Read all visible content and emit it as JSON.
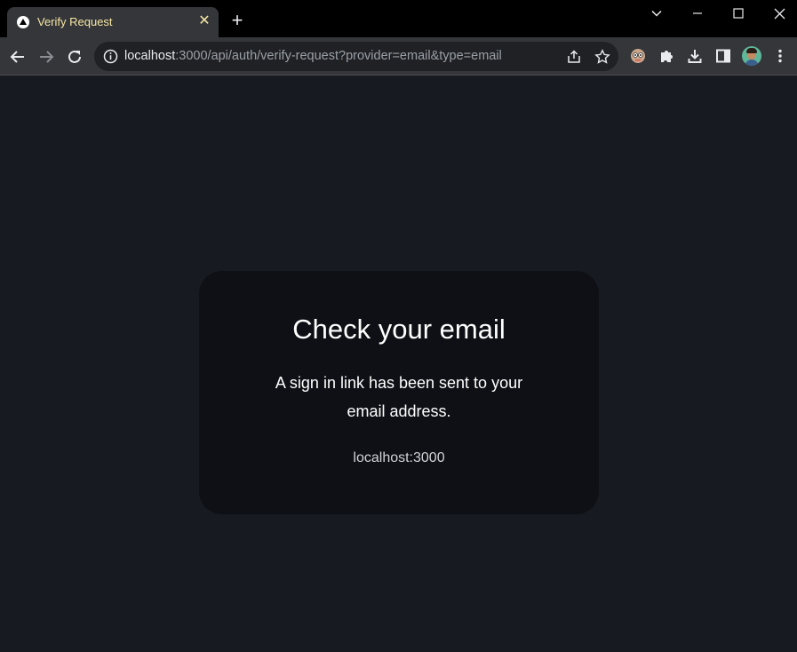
{
  "tab": {
    "title": "Verify Request",
    "close": "✕"
  },
  "newtab": "+",
  "address": {
    "host": "localhost",
    "rest": ":3000/api/auth/verify-request?provider=email&type=email"
  },
  "card": {
    "title": "Check your email",
    "text": "A sign in link has been sent to your email address.",
    "host": "localhost:3000"
  },
  "colors": {
    "page_background": "#171a21",
    "card_background": "#0e1015",
    "tab_title": "#f5e6a3"
  }
}
